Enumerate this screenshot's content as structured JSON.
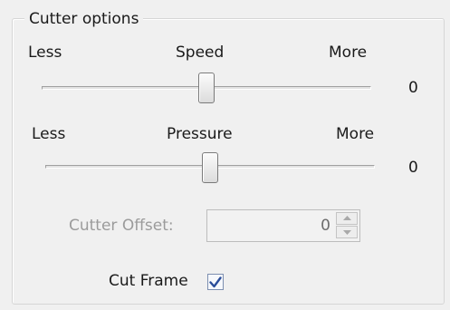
{
  "group": {
    "title": "Cutter options"
  },
  "speed": {
    "less_label": "Less",
    "title": "Speed",
    "more_label": "More",
    "value": "0",
    "level": 0.5
  },
  "pressure": {
    "less_label": "Less",
    "title": "Pressure",
    "more_label": "More",
    "value": "0",
    "level": 0.5
  },
  "cutter_offset": {
    "label": "Cutter Offset:",
    "value": "0",
    "enabled": false
  },
  "cut_frame": {
    "label": "Cut Frame",
    "checked": true
  },
  "colors": {
    "panel_bg": "#f0f0f0",
    "disabled_text": "#9b9b9b",
    "check_mark": "#2a4d9a"
  },
  "icons": {
    "spin_up": "spin-up-arrow-icon",
    "spin_down": "spin-down-arrow-icon",
    "check": "checkmark-icon"
  }
}
